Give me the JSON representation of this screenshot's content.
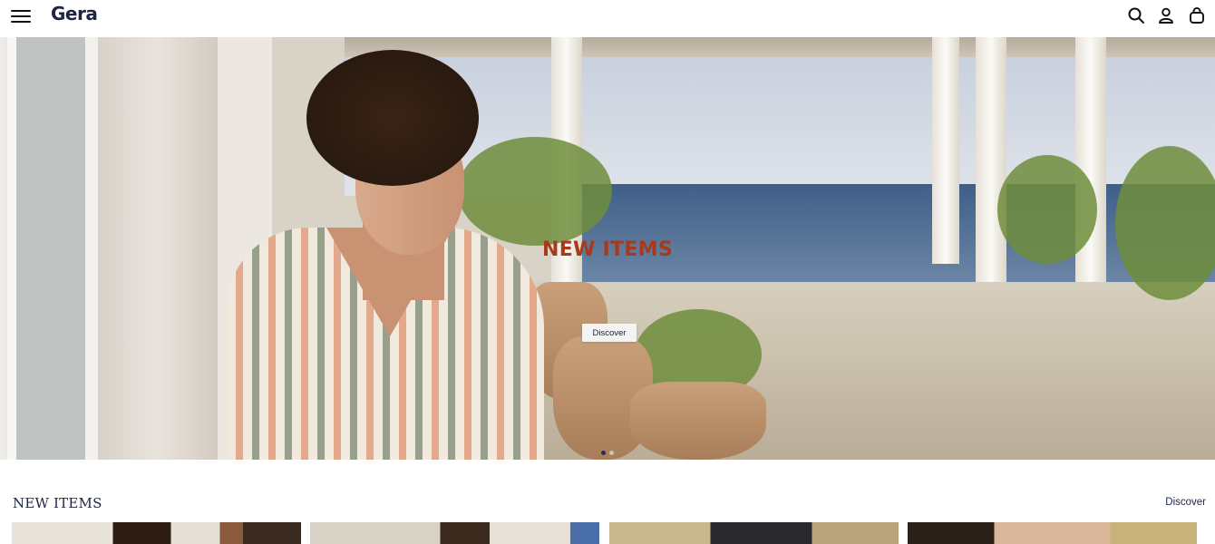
{
  "header": {
    "logo": "Gera",
    "icons": [
      "menu-icon",
      "search-icon",
      "user-icon",
      "bag-icon"
    ]
  },
  "hero": {
    "title": "NEW ITEMS",
    "button_label": "Discover",
    "slides_count": 2,
    "active_slide": 1,
    "title_color": "#a83a1c"
  },
  "section": {
    "title": "NEW ITEMS",
    "link_label": "Discover"
  },
  "products": [
    {
      "name": "product-card-1"
    },
    {
      "name": "product-card-2"
    },
    {
      "name": "product-card-3"
    },
    {
      "name": "product-card-4"
    }
  ],
  "colors": {
    "brand_navy": "#1d2446",
    "accent": "#a83a1c"
  }
}
